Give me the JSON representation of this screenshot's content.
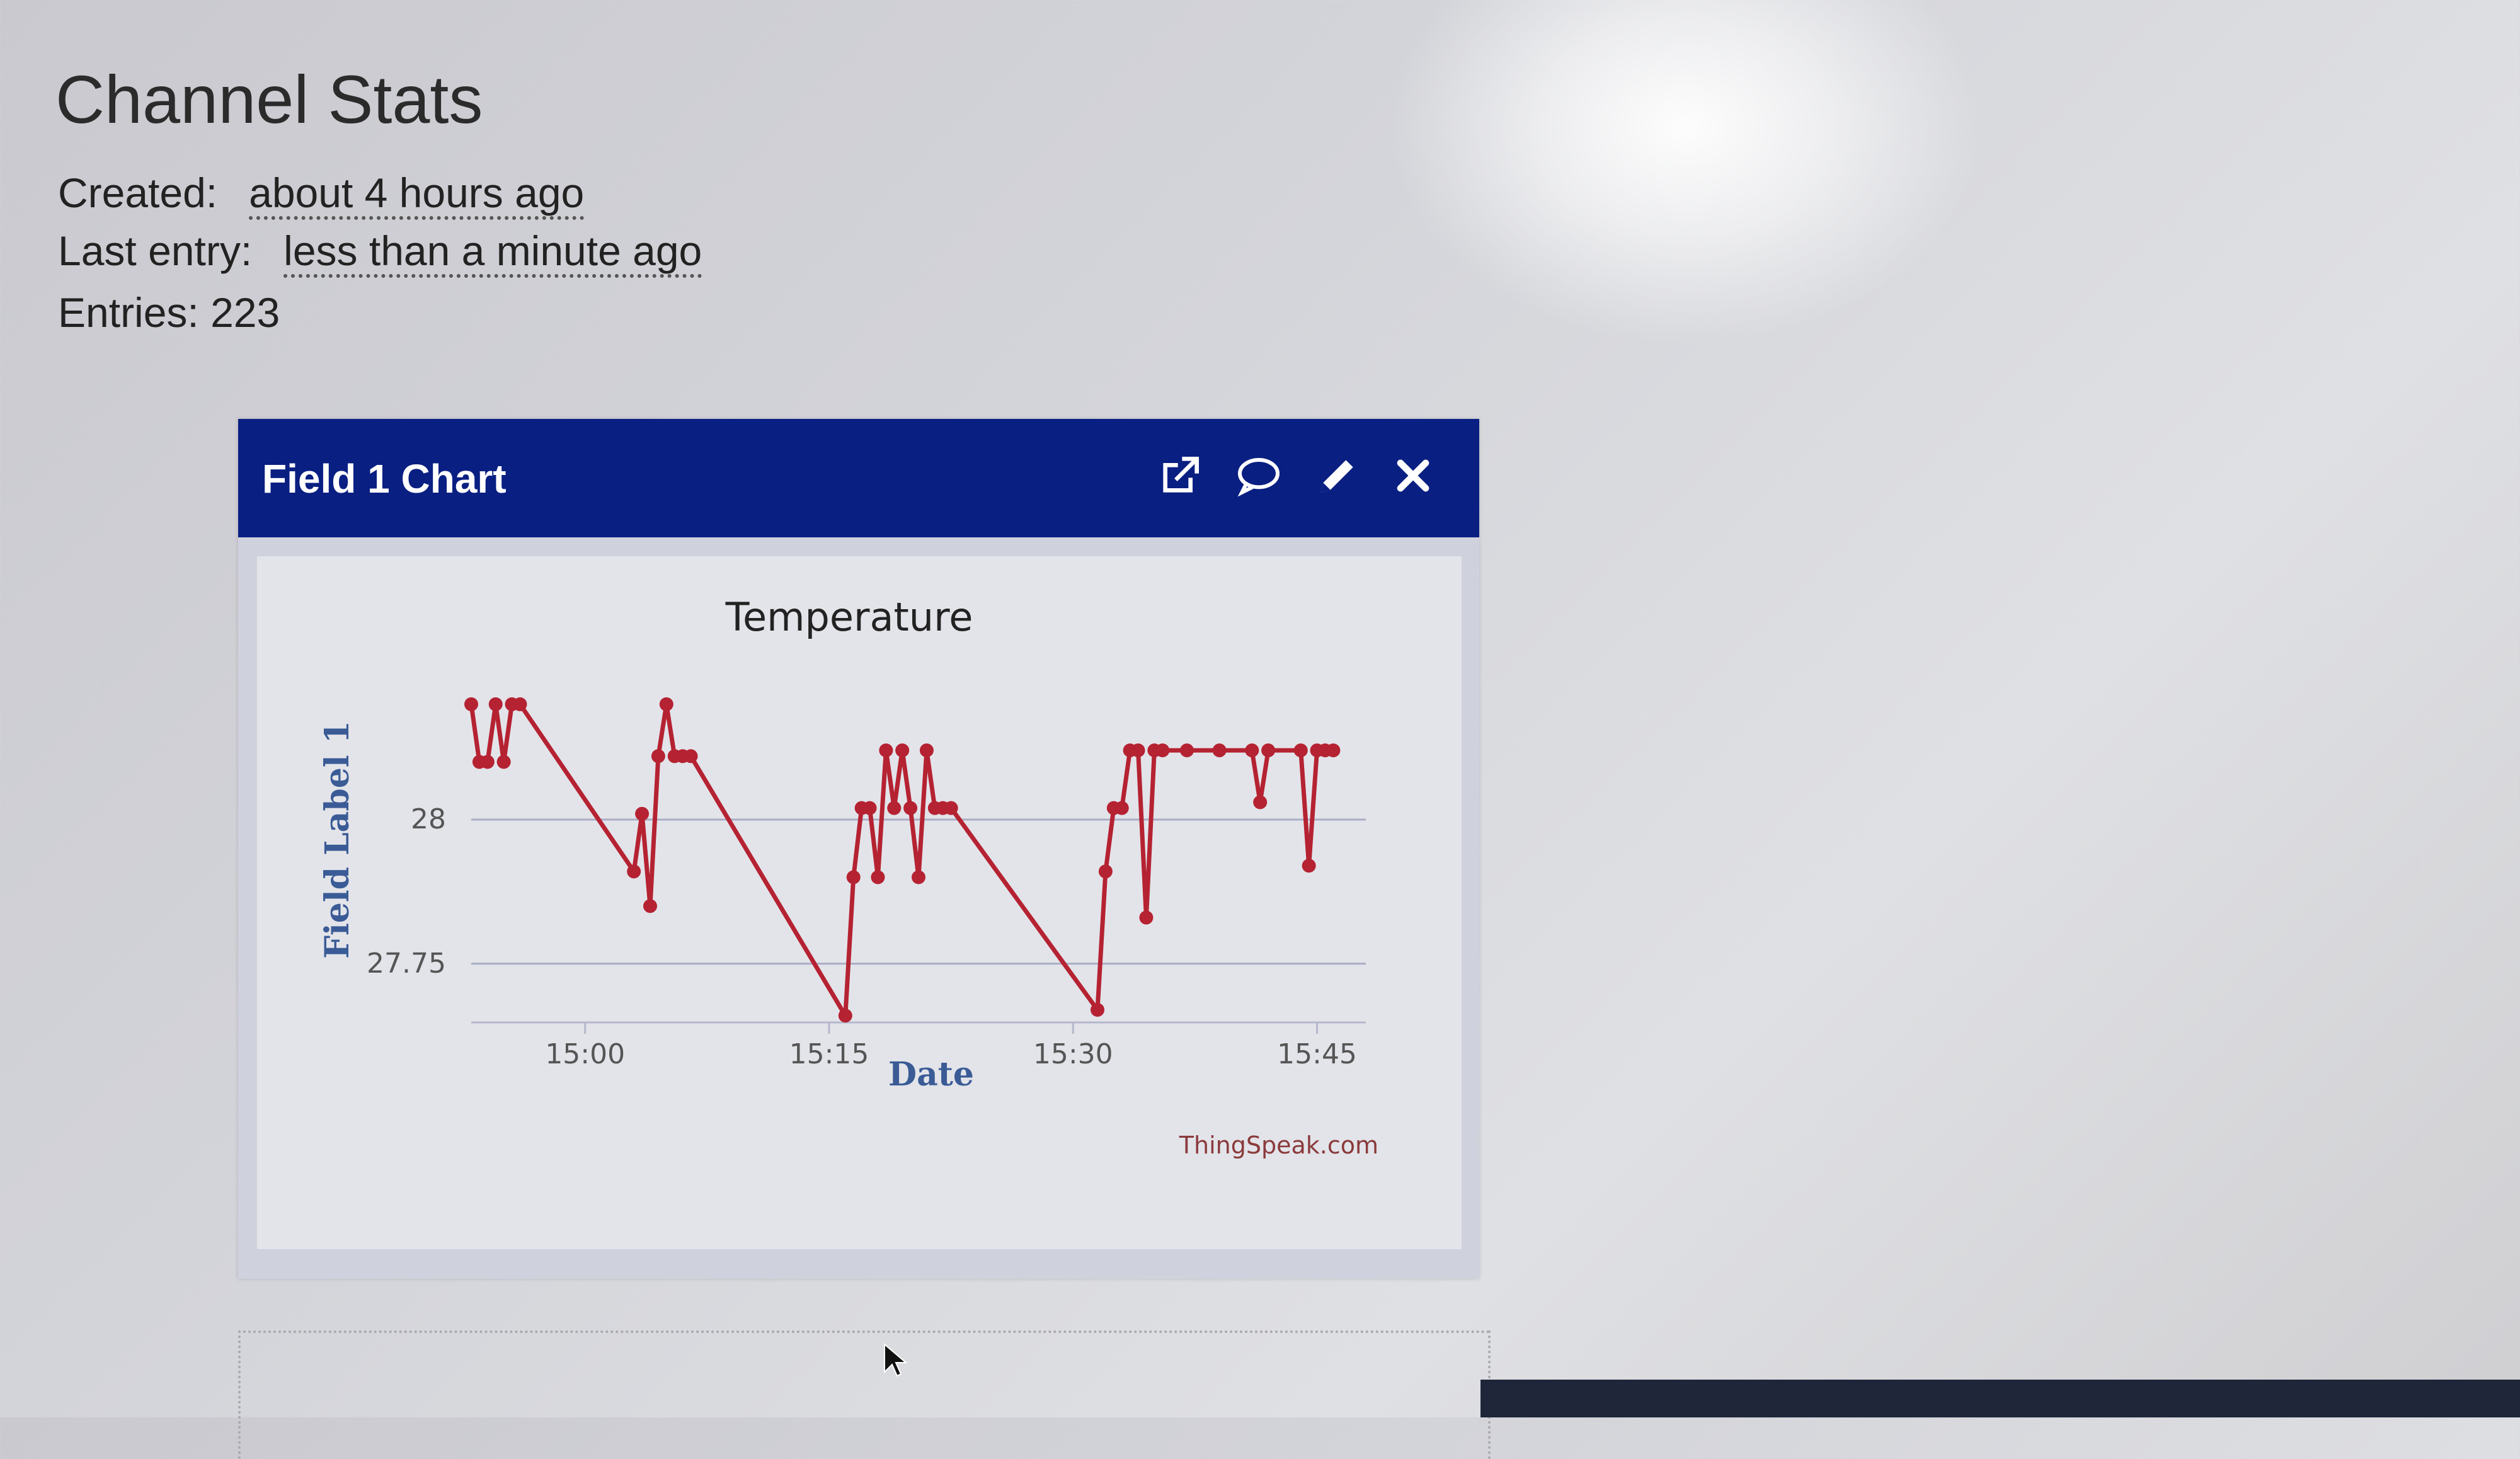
{
  "stats": {
    "title": "Channel Stats",
    "created_label": "Created:",
    "created_value": "about 4 hours ago",
    "last_entry_label": "Last entry:",
    "last_entry_value": "less than a minute ago",
    "entries_text": "Entries: 223"
  },
  "panel": {
    "title": "Field 1 Chart",
    "icons": [
      "external-link-icon",
      "comment-icon",
      "pencil-icon",
      "close-icon"
    ]
  },
  "chart_data": {
    "type": "line",
    "title": "Temperature",
    "xlabel": "Date",
    "ylabel": "Field Label 1",
    "credit": "ThingSpeak.com",
    "x_ticks": [
      "15:00",
      "15:15",
      "15:30",
      "15:45"
    ],
    "y_ticks": [
      28,
      27.75
    ],
    "xlim": [
      "14:53",
      "15:48"
    ],
    "ylim": [
      27.67,
      28.26
    ],
    "grid": true,
    "color": "#b52232",
    "series": [
      {
        "x": [
          "14:53",
          "14:53.5",
          "14:54",
          "14:54.5",
          "14:55",
          "14:55.5",
          "14:56",
          "15:03",
          "15:03.5",
          "15:04",
          "15:04.5",
          "15:05",
          "15:05.5",
          "15:06",
          "15:06.5",
          "15:16",
          "15:16.5",
          "15:17",
          "15:17.5",
          "15:18",
          "15:18.5",
          "15:19",
          "15:19.5",
          "15:20",
          "15:20.5",
          "15:21",
          "15:21.5",
          "15:22",
          "15:22.5",
          "15:31.5",
          "15:32",
          "15:32.5",
          "15:33",
          "15:33.5",
          "15:34",
          "15:34.5",
          "15:35",
          "15:35.5",
          "15:37",
          "15:39",
          "15:41",
          "15:41.5",
          "15:42",
          "15:44",
          "15:44.5",
          "15:45",
          "15:45.5",
          "15:46"
        ],
        "y": [
          28.2,
          28.1,
          28.1,
          28.2,
          28.1,
          28.2,
          28.2,
          27.91,
          28.01,
          27.85,
          28.11,
          28.2,
          28.11,
          28.11,
          28.11,
          27.66,
          27.9,
          28.02,
          28.02,
          27.9,
          28.12,
          28.02,
          28.12,
          28.02,
          27.9,
          28.12,
          28.02,
          28.02,
          28.02,
          27.67,
          27.91,
          28.02,
          28.02,
          28.12,
          28.12,
          27.83,
          28.12,
          28.12,
          28.12,
          28.12,
          28.12,
          28.03,
          28.12,
          28.12,
          27.92,
          28.12,
          28.12,
          28.12
        ]
      }
    ]
  }
}
